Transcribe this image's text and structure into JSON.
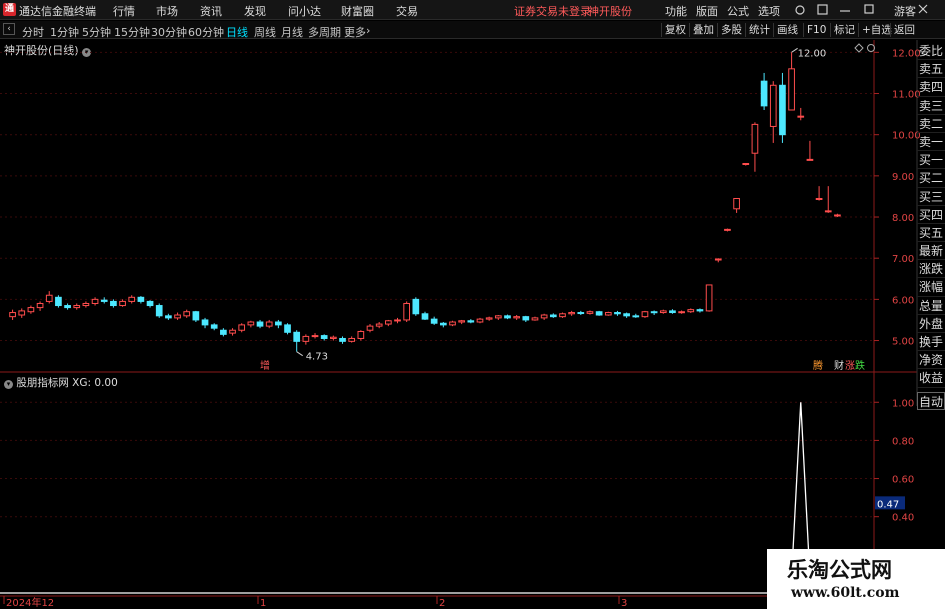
{
  "topbar": {
    "app_title": "通达信金融终端",
    "menu": [
      "行情",
      "市场",
      "资讯",
      "发现",
      "问小达",
      "财富圈",
      "交易"
    ],
    "warning": "证券交易未登录",
    "stock": "神开股份",
    "tools": [
      "功能",
      "版面",
      "公式",
      "选项"
    ],
    "guest": "游客"
  },
  "periods": [
    "分时",
    "1分钟",
    "5分钟",
    "15分钟",
    "30分钟",
    "60分钟",
    "日线",
    "周线",
    "月线",
    "多周期",
    "更多"
  ],
  "active_period": "日线",
  "toolbar_right": [
    "复权",
    "叠加",
    "多股",
    "统计",
    "画线",
    "F10",
    "标记",
    "+自选",
    "返回"
  ],
  "stock_title": "神开股份(日线)",
  "right_panel": [
    "委比",
    "卖五",
    "卖四",
    "卖三",
    "卖二",
    "卖一",
    "买一",
    "买二",
    "买三",
    "买四",
    "买五",
    "最新",
    "涨跌",
    "涨幅",
    "总量",
    "外盘",
    "换手",
    "净资",
    "收益",
    "自动"
  ],
  "indicator_label": "股朋指标网 XG: 0.00",
  "price_axis": [
    "12.00",
    "11.00",
    "10.00",
    "9.00",
    "8.00",
    "7.00",
    "6.00",
    "5.00"
  ],
  "ind_axis": [
    "1.00",
    "0.80",
    "0.60",
    "0.40"
  ],
  "ind_value": "0.47",
  "annotations": {
    "high": "12.00",
    "low": "4.73",
    "zeng": "增",
    "right_marks": [
      "腾",
      "财",
      "涨",
      "跌"
    ]
  },
  "x_axis": [
    "2024年12",
    "1",
    "2",
    "3"
  ],
  "watermark": {
    "line1": "乐淘公式网",
    "line2": "www.60lt.com"
  },
  "colors": {
    "up": "#ff4d4d",
    "down": "#4de8ff",
    "signal": "#ffffff"
  },
  "chart_data": {
    "type": "candlestick",
    "ylim": [
      4.6,
      12.3
    ],
    "candles": [
      [
        5.58,
        5.68,
        5.5,
        5.75
      ],
      [
        5.62,
        5.72,
        5.55,
        5.78
      ],
      [
        5.7,
        5.8,
        5.65,
        5.85
      ],
      [
        5.8,
        5.9,
        5.72,
        5.95
      ],
      [
        5.95,
        6.1,
        5.9,
        6.2
      ],
      [
        6.05,
        5.85,
        5.8,
        6.1
      ],
      [
        5.85,
        5.8,
        5.75,
        5.9
      ],
      [
        5.8,
        5.85,
        5.75,
        5.9
      ],
      [
        5.85,
        5.9,
        5.8,
        5.95
      ],
      [
        5.9,
        6.0,
        5.85,
        6.05
      ],
      [
        5.98,
        5.95,
        5.9,
        6.05
      ],
      [
        5.95,
        5.85,
        5.8,
        6.0
      ],
      [
        5.85,
        5.95,
        5.82,
        6.0
      ],
      [
        5.95,
        6.05,
        5.9,
        6.1
      ],
      [
        6.05,
        5.95,
        5.9,
        6.08
      ],
      [
        5.95,
        5.85,
        5.8,
        5.98
      ],
      [
        5.85,
        5.6,
        5.55,
        5.9
      ],
      [
        5.6,
        5.55,
        5.5,
        5.65
      ],
      [
        5.55,
        5.62,
        5.5,
        5.68
      ],
      [
        5.6,
        5.7,
        5.55,
        5.75
      ],
      [
        5.7,
        5.5,
        5.45,
        5.72
      ],
      [
        5.5,
        5.38,
        5.3,
        5.55
      ],
      [
        5.38,
        5.3,
        5.25,
        5.42
      ],
      [
        5.25,
        5.15,
        5.1,
        5.3
      ],
      [
        5.18,
        5.25,
        5.12,
        5.3
      ],
      [
        5.25,
        5.38,
        5.2,
        5.42
      ],
      [
        5.38,
        5.45,
        5.32,
        5.48
      ],
      [
        5.45,
        5.35,
        5.3,
        5.5
      ],
      [
        5.35,
        5.45,
        5.3,
        5.5
      ],
      [
        5.45,
        5.38,
        5.3,
        5.5
      ],
      [
        5.38,
        5.2,
        5.15,
        5.42
      ],
      [
        5.2,
        4.98,
        4.73,
        5.25
      ],
      [
        4.98,
        5.1,
        4.9,
        5.15
      ],
      [
        5.1,
        5.12,
        5.05,
        5.18
      ],
      [
        5.12,
        5.05,
        5.0,
        5.15
      ],
      [
        5.05,
        5.08,
        5.0,
        5.12
      ],
      [
        5.05,
        4.98,
        4.92,
        5.1
      ],
      [
        4.98,
        5.05,
        4.95,
        5.1
      ],
      [
        5.05,
        5.22,
        5.0,
        5.25
      ],
      [
        5.25,
        5.35,
        5.2,
        5.4
      ],
      [
        5.35,
        5.4,
        5.3,
        5.45
      ],
      [
        5.4,
        5.48,
        5.35,
        5.5
      ],
      [
        5.48,
        5.5,
        5.42,
        5.55
      ],
      [
        5.5,
        5.9,
        5.45,
        5.95
      ],
      [
        6.0,
        5.65,
        5.6,
        6.05
      ],
      [
        5.65,
        5.52,
        5.5,
        5.7
      ],
      [
        5.52,
        5.42,
        5.38,
        5.58
      ],
      [
        5.42,
        5.38,
        5.32,
        5.45
      ],
      [
        5.38,
        5.45,
        5.35,
        5.48
      ],
      [
        5.45,
        5.48,
        5.4,
        5.5
      ],
      [
        5.48,
        5.45,
        5.42,
        5.52
      ],
      [
        5.45,
        5.52,
        5.42,
        5.55
      ],
      [
        5.52,
        5.55,
        5.48,
        5.58
      ],
      [
        5.55,
        5.6,
        5.5,
        5.62
      ],
      [
        5.6,
        5.55,
        5.52,
        5.63
      ],
      [
        5.55,
        5.58,
        5.5,
        5.62
      ],
      [
        5.58,
        5.5,
        5.45,
        5.6
      ],
      [
        5.5,
        5.55,
        5.48,
        5.58
      ],
      [
        5.55,
        5.62,
        5.5,
        5.65
      ],
      [
        5.62,
        5.58,
        5.55,
        5.66
      ],
      [
        5.58,
        5.65,
        5.55,
        5.68
      ],
      [
        5.65,
        5.68,
        5.6,
        5.72
      ],
      [
        5.68,
        5.66,
        5.62,
        5.72
      ],
      [
        5.66,
        5.7,
        5.63,
        5.73
      ],
      [
        5.7,
        5.62,
        5.6,
        5.72
      ],
      [
        5.62,
        5.68,
        5.6,
        5.7
      ],
      [
        5.68,
        5.65,
        5.6,
        5.72
      ],
      [
        5.65,
        5.6,
        5.55,
        5.68
      ],
      [
        5.6,
        5.58,
        5.55,
        5.65
      ],
      [
        5.58,
        5.7,
        5.55,
        5.72
      ],
      [
        5.7,
        5.68,
        5.62,
        5.73
      ],
      [
        5.68,
        5.72,
        5.65,
        5.75
      ],
      [
        5.72,
        5.68,
        5.65,
        5.76
      ],
      [
        5.68,
        5.7,
        5.65,
        5.73
      ],
      [
        5.7,
        5.75,
        5.67,
        5.78
      ],
      [
        5.75,
        5.72,
        5.68,
        5.78
      ],
      [
        5.72,
        6.35,
        5.7,
        6.35
      ],
      [
        6.98,
        6.98,
        6.9,
        7.0
      ],
      [
        7.68,
        7.7,
        7.65,
        7.72
      ],
      [
        8.2,
        8.45,
        8.1,
        8.45
      ],
      [
        9.3,
        9.3,
        9.25,
        9.3
      ],
      [
        9.55,
        10.25,
        9.1,
        10.3
      ],
      [
        11.3,
        10.7,
        10.6,
        11.5
      ],
      [
        10.2,
        11.2,
        9.8,
        11.3
      ],
      [
        11.2,
        10.0,
        9.8,
        11.5
      ],
      [
        10.6,
        11.6,
        10.6,
        12.0
      ],
      [
        10.45,
        10.45,
        10.35,
        10.65
      ],
      [
        9.4,
        9.4,
        9.4,
        9.85
      ],
      [
        8.45,
        8.45,
        8.4,
        8.75
      ],
      [
        8.15,
        8.15,
        8.1,
        8.75
      ],
      [
        8.05,
        8.05,
        8.0,
        8.08
      ]
    ],
    "signal": {
      "index": 86,
      "value": 1.0
    },
    "ind_ylim": [
      0,
      1.08
    ]
  }
}
